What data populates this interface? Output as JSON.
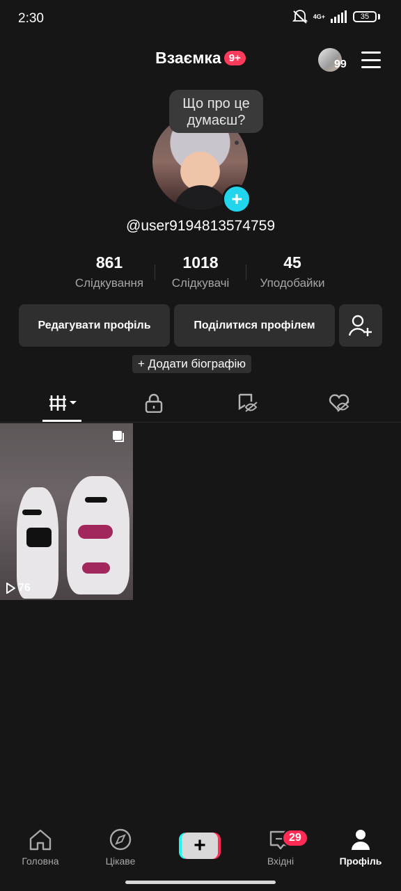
{
  "status_bar": {
    "time": "2:30",
    "network": "4G+",
    "battery": "35"
  },
  "header": {
    "title": "Взаємка",
    "badge": "9+",
    "avatar_count": "99"
  },
  "profile": {
    "bubble_text_line1": "Що про це",
    "bubble_text_line2": "думаєш?",
    "username": "@user9194813574759"
  },
  "stats": [
    {
      "value": "861",
      "label": "Слідкування"
    },
    {
      "value": "1018",
      "label": "Слідкувачі"
    },
    {
      "value": "45",
      "label": "Уподобайки"
    }
  ],
  "actions": {
    "edit_profile": "Редагувати профіль",
    "share_profile": "Поділитися профілем",
    "add_bio": "+ Додати біографію"
  },
  "tabs": [
    "videos-grid-icon",
    "lock-icon",
    "repost-eye-icon",
    "liked-eye-icon"
  ],
  "video": {
    "views": "76"
  },
  "nav": [
    {
      "label": "Головна",
      "icon": "home-icon"
    },
    {
      "label": "Цікаве",
      "icon": "compass-icon"
    },
    {
      "label": "",
      "icon": "create-icon"
    },
    {
      "label": "Вхідні",
      "icon": "inbox-icon",
      "badge": "29"
    },
    {
      "label": "Профіль",
      "icon": "profile-icon"
    }
  ],
  "colors": {
    "background": "#161616",
    "accent_red": "#fe2c55",
    "accent_cyan": "#20d5ec"
  }
}
